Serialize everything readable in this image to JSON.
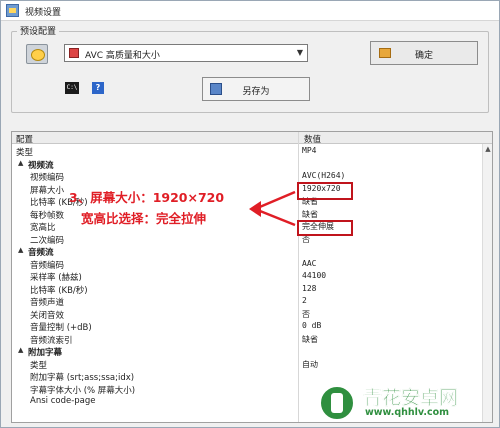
{
  "window": {
    "title": "视频设置"
  },
  "preset_group": {
    "label": "预设配置",
    "selected_preset": "AVC 高质量和大小",
    "ok_button": "确定",
    "save_as_button": "另存为",
    "cmd_icon_text": "C:\\",
    "help_icon_text": "?"
  },
  "grid": {
    "col_config": "配置",
    "col_value": "数值",
    "rows": [
      {
        "name": "类型",
        "value": "MP4",
        "section": false,
        "indent": 0
      },
      {
        "name": "视频流",
        "value": "",
        "section": true,
        "indent": 0
      },
      {
        "name": "视频编码",
        "value": "AVC(H264)",
        "section": false,
        "indent": 1
      },
      {
        "name": "屏幕大小",
        "value": "1920x720",
        "section": false,
        "indent": 1
      },
      {
        "name": "比特率 (KB/秒)",
        "value": "缺省",
        "section": false,
        "indent": 1
      },
      {
        "name": "每秒帧数",
        "value": "缺省",
        "section": false,
        "indent": 1
      },
      {
        "name": "宽高比",
        "value": "完全伸展",
        "section": false,
        "indent": 1
      },
      {
        "name": "二次编码",
        "value": "否",
        "section": false,
        "indent": 1
      },
      {
        "name": "音频流",
        "value": "",
        "section": true,
        "indent": 0
      },
      {
        "name": "音频编码",
        "value": "AAC",
        "section": false,
        "indent": 1
      },
      {
        "name": "采样率 (赫兹)",
        "value": "44100",
        "section": false,
        "indent": 1
      },
      {
        "name": "比特率 (KB/秒)",
        "value": "128",
        "section": false,
        "indent": 1
      },
      {
        "name": "音频声道",
        "value": "2",
        "section": false,
        "indent": 1
      },
      {
        "name": "关闭音效",
        "value": "否",
        "section": false,
        "indent": 1
      },
      {
        "name": "音量控制 (+dB)",
        "value": "0 dB",
        "section": false,
        "indent": 1
      },
      {
        "name": "音频流索引",
        "value": "缺省",
        "section": false,
        "indent": 1
      },
      {
        "name": "附加字幕",
        "value": "",
        "section": true,
        "indent": 0
      },
      {
        "name": "类型",
        "value": "自动",
        "section": false,
        "indent": 1
      },
      {
        "name": "附加字幕 (srt;ass;ssa;idx)",
        "value": "",
        "section": false,
        "indent": 1
      },
      {
        "name": "字幕字体大小 (% 屏幕大小)",
        "value": "",
        "section": false,
        "indent": 1
      },
      {
        "name": "Ansi code-page",
        "value": "",
        "section": false,
        "indent": 1
      }
    ]
  },
  "annotation": {
    "line1": "3、屏幕大小：1920×720",
    "line2": "宽高比选择：完全拉伸",
    "color": "#e01e26"
  },
  "watermark": {
    "title": "青花安卓网",
    "url": "www.qhhlv.com"
  }
}
